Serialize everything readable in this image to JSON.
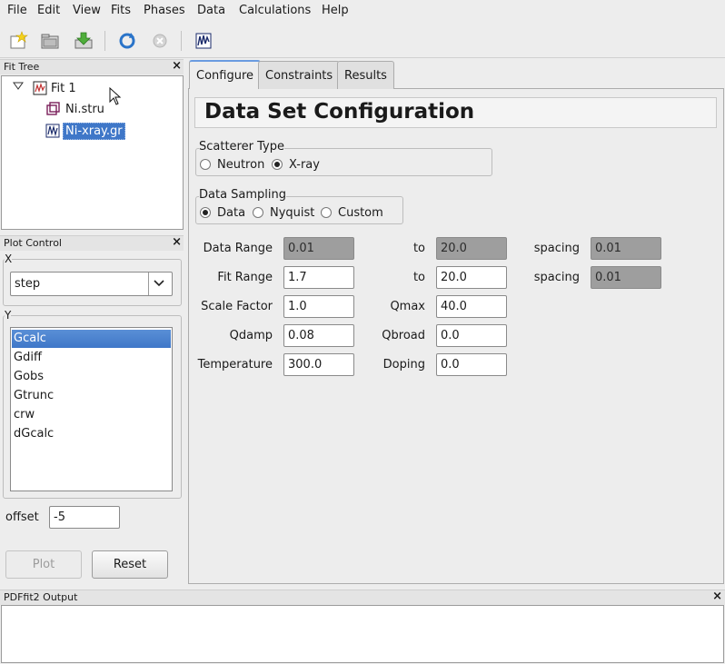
{
  "menu": [
    "File",
    "Edit",
    "View",
    "Fits",
    "Phases",
    "Data",
    "Calculations",
    "Help"
  ],
  "toolbar": {
    "icons": [
      "new-fit-icon",
      "open-icon",
      "download-icon",
      "refresh-icon",
      "stop-icon",
      "plot-icon"
    ]
  },
  "fit_tree": {
    "title": "Fit Tree",
    "close": "×",
    "items": [
      "Fit 1",
      "Ni.stru",
      "Ni-xray.gr"
    ]
  },
  "plot_control": {
    "title": "Plot Control",
    "close": "×",
    "x_label": "X",
    "x_value": "step",
    "y_label": "Y",
    "y_items": [
      "Gcalc",
      "Gdiff",
      "Gobs",
      "Gtrunc",
      "crw",
      "dGcalc"
    ],
    "y_selected": "Gcalc",
    "offset_label": "offset",
    "offset_value": "-5",
    "plot_button": "Plot",
    "reset_button": "Reset"
  },
  "tabs": [
    "Configure",
    "Constraints",
    "Results"
  ],
  "active_tab": "Configure",
  "config": {
    "title": "Data Set Configuration",
    "scatterer": {
      "label": "Scatterer Type",
      "options": [
        "Neutron",
        "X-ray"
      ],
      "selected": "X-ray"
    },
    "sampling": {
      "label": "Data Sampling",
      "options": [
        "Data",
        "Nyquist",
        "Custom"
      ],
      "selected": "Data"
    },
    "fields": {
      "data_range_label": "Data Range",
      "data_range_from": "0.01",
      "data_range_to_label": "to",
      "data_range_to": "20.0",
      "data_spacing_label": "spacing",
      "data_spacing": "0.01",
      "fit_range_label": "Fit Range",
      "fit_range_from": "1.7",
      "fit_range_to_label": "to",
      "fit_range_to": "20.0",
      "fit_spacing_label": "spacing",
      "fit_spacing": "0.01",
      "scale_factor_label": "Scale Factor",
      "scale_factor": "1.0",
      "qmax_label": "Qmax",
      "qmax": "40.0",
      "qdamp_label": "Qdamp",
      "qdamp": "0.08",
      "qbroad_label": "Qbroad",
      "qbroad": "0.0",
      "temperature_label": "Temperature",
      "temperature": "300.0",
      "doping_label": "Doping",
      "doping": "0.0"
    }
  },
  "output": {
    "title": "PDFfit2 Output",
    "close": "×"
  }
}
